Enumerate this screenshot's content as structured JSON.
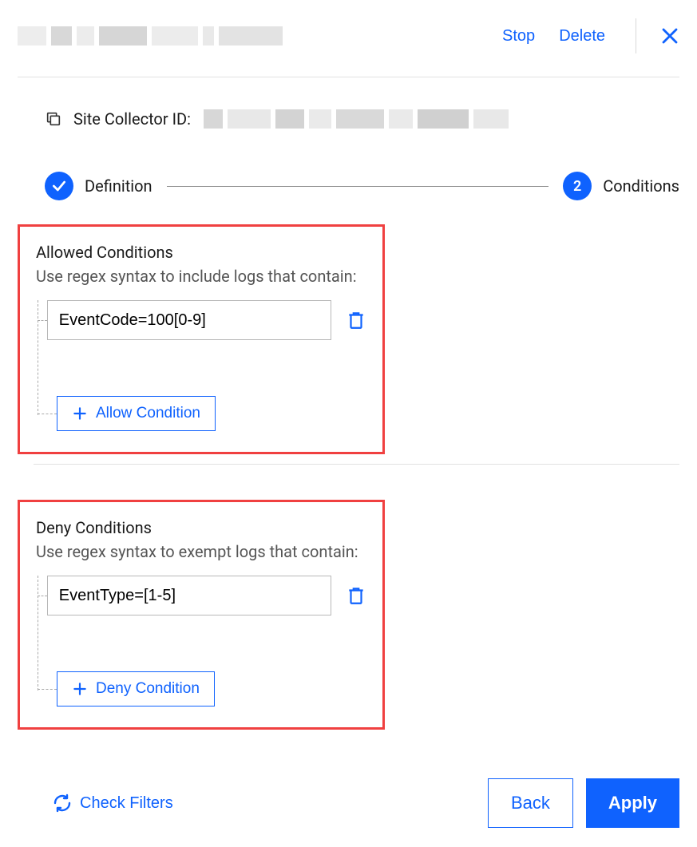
{
  "header": {
    "stop": "Stop",
    "delete": "Delete"
  },
  "site_collector": {
    "label": "Site Collector ID:"
  },
  "stepper": {
    "step1_label": "Definition",
    "step2_number": "2",
    "step2_label": "Conditions"
  },
  "allowed": {
    "title": "Allowed Conditions",
    "subtitle": "Use regex syntax to include logs that contain:",
    "conditions": [
      {
        "value": "EventCode=100[0-9]"
      }
    ],
    "add_label": "Allow Condition"
  },
  "deny": {
    "title": "Deny Conditions",
    "subtitle": "Use regex syntax to exempt logs that contain:",
    "conditions": [
      {
        "value": "EventType=[1-5]"
      }
    ],
    "add_label": "Deny Condition"
  },
  "footer": {
    "check_filters": "Check Filters",
    "back": "Back",
    "apply": "Apply"
  }
}
